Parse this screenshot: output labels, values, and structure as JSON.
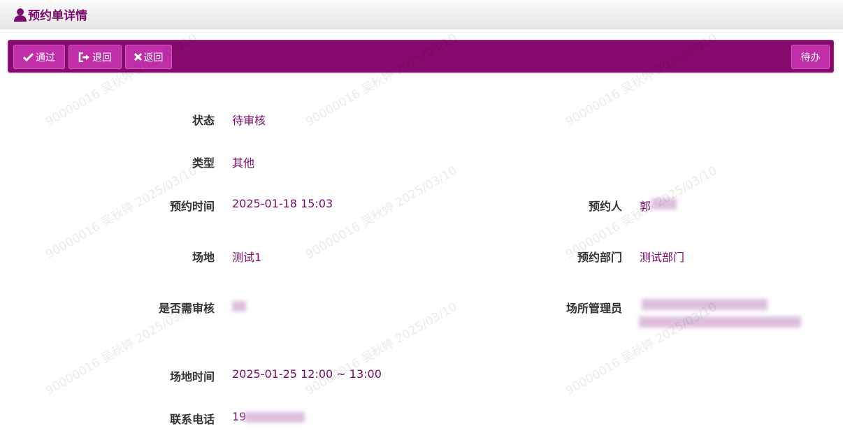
{
  "header": {
    "title": "预约单详情",
    "icon": "user-icon"
  },
  "toolbar": {
    "approve_label": "通过",
    "return_label": "退回",
    "back_label": "返回",
    "todo_label": "待办"
  },
  "fields": {
    "status": {
      "label": "状态",
      "value": "待审核"
    },
    "type": {
      "label": "类型",
      "value": "其他"
    },
    "booking_time": {
      "label": "预约时间",
      "value": "2025-01-18 15:03"
    },
    "booker": {
      "label": "预约人",
      "value": "郭"
    },
    "venue": {
      "label": "场地",
      "value": "测试1"
    },
    "department": {
      "label": "预约部门",
      "value": "测试部门"
    },
    "needs_review": {
      "label": "是否需审核"
    },
    "venue_admin": {
      "label": "场所管理员"
    },
    "venue_time": {
      "label": "场地时间",
      "value": "2025-01-25 12:00 ~ 13:00"
    },
    "phone": {
      "label": "联系电话",
      "value": "19"
    }
  },
  "watermark": {
    "text": "90000016 吴秋婷 2025/03/10"
  },
  "colors": {
    "accent": "#870a6e",
    "button": "#c02eaa",
    "value_text": "#7d0a6e"
  }
}
